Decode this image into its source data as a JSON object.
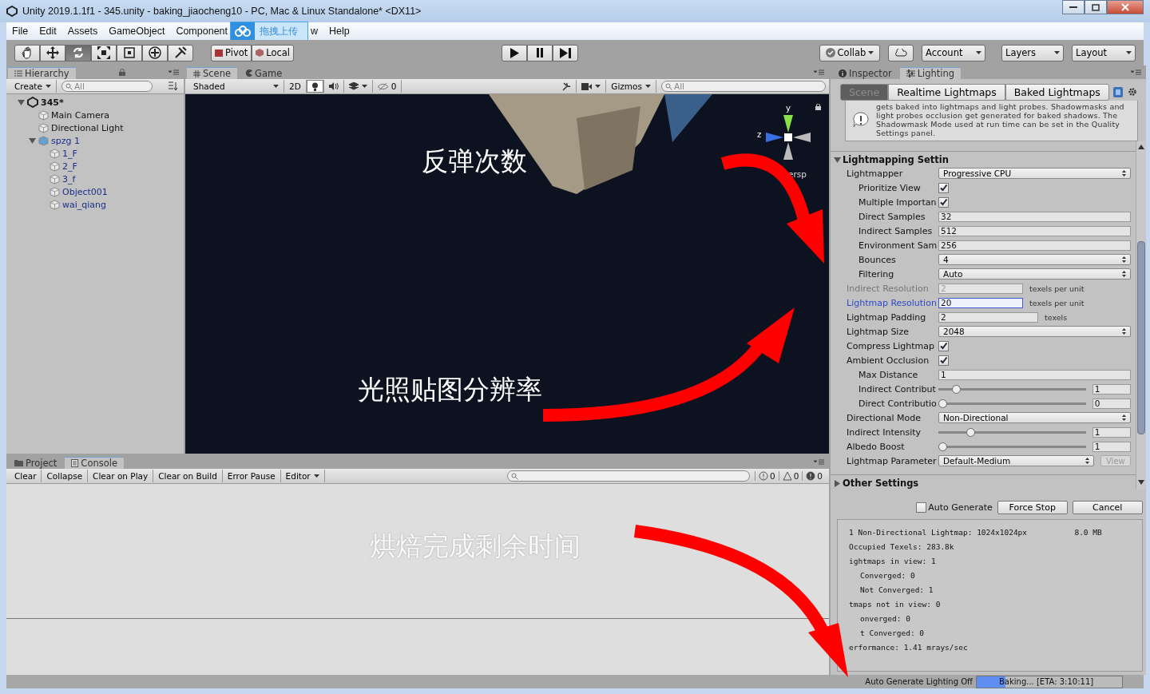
{
  "window": {
    "title": "Unity 2019.1.1f1 - 345.unity - baking_jiaocheng10 - PC, Mac & Linux Standalone* <DX11>"
  },
  "menu": [
    {
      "kind": "menu",
      "label": "File"
    },
    {
      "kind": "menu",
      "label": "Edit"
    },
    {
      "kind": "menu",
      "label": "Assets"
    },
    {
      "kind": "menu",
      "label": "GameObject"
    },
    {
      "kind": "menu",
      "label": "Component"
    },
    {
      "kind": "upload",
      "label": "拖拽上传"
    },
    {
      "kind": "menu",
      "label": "w"
    },
    {
      "kind": "menu",
      "label": "Help"
    }
  ],
  "toolbar": {
    "tools": [
      {
        "kind": "hand",
        "selected": false
      },
      {
        "kind": "move",
        "selected": false
      },
      {
        "kind": "rotate",
        "selected": true
      },
      {
        "kind": "scale",
        "selected": false
      },
      {
        "kind": "rect",
        "selected": false
      },
      {
        "kind": "transform",
        "selected": false
      },
      {
        "kind": "custom",
        "selected": false
      }
    ],
    "pivot": "Pivot",
    "local": "Local",
    "collab": "Collab",
    "account": "Account",
    "layers": "Layers",
    "layout": "Layout"
  },
  "hierarchy": {
    "tab": "Hierarchy",
    "create": "Create",
    "search_placeholder": "All",
    "scene": {
      "name": "345*",
      "expanded": true,
      "children": [
        {
          "name": "Main Camera",
          "kind": "object"
        },
        {
          "name": "Directional Light",
          "kind": "object"
        },
        {
          "name": "spzg 1",
          "kind": "prefab",
          "expanded": true,
          "children": [
            {
              "name": "1_F",
              "kind": "prefab"
            },
            {
              "name": "2_F",
              "kind": "prefab"
            },
            {
              "name": "3_f",
              "kind": "prefab"
            },
            {
              "name": "Object001",
              "kind": "prefab"
            },
            {
              "name": "wai_qiang",
              "kind": "prefab"
            }
          ]
        }
      ]
    }
  },
  "scene_view": {
    "tabs": [
      {
        "label": "Scene",
        "selected": true
      },
      {
        "label": "Game",
        "selected": false
      }
    ],
    "shading": "Shaded",
    "mode_2d": "2D",
    "toggles": [
      {
        "kind": "lighting",
        "on": true
      },
      {
        "kind": "audio",
        "on": false
      },
      {
        "kind": "effects",
        "on": false
      }
    ],
    "tools_on": false,
    "hidden_count": "0",
    "gizmos": "Gizmos",
    "search_placeholder": "All",
    "axis_y": "y",
    "axis_z": "z",
    "projection": "ersp"
  },
  "annotations": [
    {
      "text": "反弹次数"
    },
    {
      "text": "光照贴图分辨率"
    },
    {
      "text": "烘焙完成剩余时间"
    }
  ],
  "inspector": {
    "tabs": [
      {
        "label": "Inspector",
        "selected": false
      },
      {
        "label": "Lighting",
        "selected": true
      }
    ],
    "lighting_tabs": [
      {
        "label": "Scene",
        "selected": true
      },
      {
        "label": "Realtime Lightmaps",
        "selected": false
      },
      {
        "label": "Baked Lightmaps",
        "selected": false
      }
    ],
    "help_text": "gets baked into lightmaps and light probes. Shadowmasks and light probes occlusion get generated for baked shadows. The Shadowmask Mode used at run time can be set in the Quality Settings panel.",
    "sections": [
      {
        "title": "Lightmapping Settin",
        "expanded": true,
        "rows": [
          {
            "kind": "dropdown",
            "label": "Lightmapper",
            "value": "Progressive CPU",
            "children": [
              {
                "kind": "checkbox",
                "label": "Prioritize View",
                "checked": true
              },
              {
                "kind": "checkbox",
                "label": "Multiple Importan",
                "checked": true
              },
              {
                "kind": "field",
                "label": "Direct Samples",
                "value": "32"
              },
              {
                "kind": "field",
                "label": "Indirect Samples",
                "value": "512"
              },
              {
                "kind": "field",
                "label": "Environment Sam",
                "value": "256"
              },
              {
                "kind": "dropdown",
                "label": "Bounces",
                "value": "4"
              },
              {
                "kind": "dropdown",
                "label": "Filtering",
                "value": "Auto"
              }
            ]
          },
          {
            "kind": "field",
            "label": "Indirect Resolution",
            "value": "2",
            "suffix": "texels per unit",
            "disabled": true,
            "focused": false
          },
          {
            "kind": "field",
            "label": "Lightmap Resolution",
            "value": "20",
            "suffix": "texels per unit",
            "disabled": false,
            "focused": true
          },
          {
            "kind": "field",
            "label": "Lightmap Padding",
            "value": "2",
            "suffix": "texels",
            "disabled": false,
            "focused": false
          },
          {
            "kind": "dropdown",
            "label": "Lightmap Size",
            "value": "2048"
          },
          {
            "kind": "checkbox",
            "label": "Compress Lightmap",
            "checked": true
          },
          {
            "kind": "checkbox",
            "label": "Ambient Occlusion",
            "checked": true,
            "children": [
              {
                "kind": "field",
                "label": "Max Distance",
                "value": "1"
              },
              {
                "kind": "slider",
                "label": "Indirect Contribut",
                "level": 0.1,
                "value": "1"
              },
              {
                "kind": "slider",
                "label": "Direct Contributio",
                "level": 0,
                "value": "0"
              }
            ]
          },
          {
            "kind": "dropdown",
            "label": "Directional Mode",
            "value": "Non-Directional"
          },
          {
            "kind": "slider",
            "label": "Indirect Intensity",
            "level": 0.2,
            "value": "1"
          },
          {
            "kind": "slider",
            "label": "Albedo Boost",
            "level": 0,
            "value": "1"
          },
          {
            "kind": "dropdown",
            "label": "Lightmap Parameter",
            "value": "Default-Medium",
            "button": "View"
          }
        ]
      },
      {
        "title": "Other Settings",
        "expanded": false
      }
    ],
    "auto_generate": {
      "label": "Auto Generate",
      "checked": false
    },
    "buttons": [
      "Force Stop",
      "Cancel"
    ],
    "stats": [
      {
        "text": "1 Non-Directional Lightmap: 1024x1024px",
        "value": "8.0 MB"
      },
      {
        "text": "Occupied Texels: 283.8k"
      },
      {
        "text": "ightmaps in view: 1",
        "children": [
          {
            "text": "Converged: 0"
          },
          {
            "text": "Not Converged: 1"
          }
        ]
      },
      {
        "text": "tmaps not in view: 0",
        "children": [
          {
            "text": "onverged: 0"
          },
          {
            "text": "t Converged: 0"
          }
        ]
      },
      {
        "text": "erformance: 1.41 mrays/sec"
      }
    ]
  },
  "console": {
    "tabs": [
      {
        "label": "Project",
        "selected": false
      },
      {
        "label": "Console",
        "selected": true
      }
    ],
    "buttons": [
      "Clear",
      "Collapse",
      "Clear on Play",
      "Clear on Build",
      "Error Pause"
    ],
    "editor": "Editor",
    "counts": [
      "0",
      "0",
      "0"
    ]
  },
  "status_bar": {
    "message": "Auto Generate Lighting Off",
    "progress": {
      "label": "Baking... [ETA: 3:10:11]",
      "level": 0.2
    }
  }
}
